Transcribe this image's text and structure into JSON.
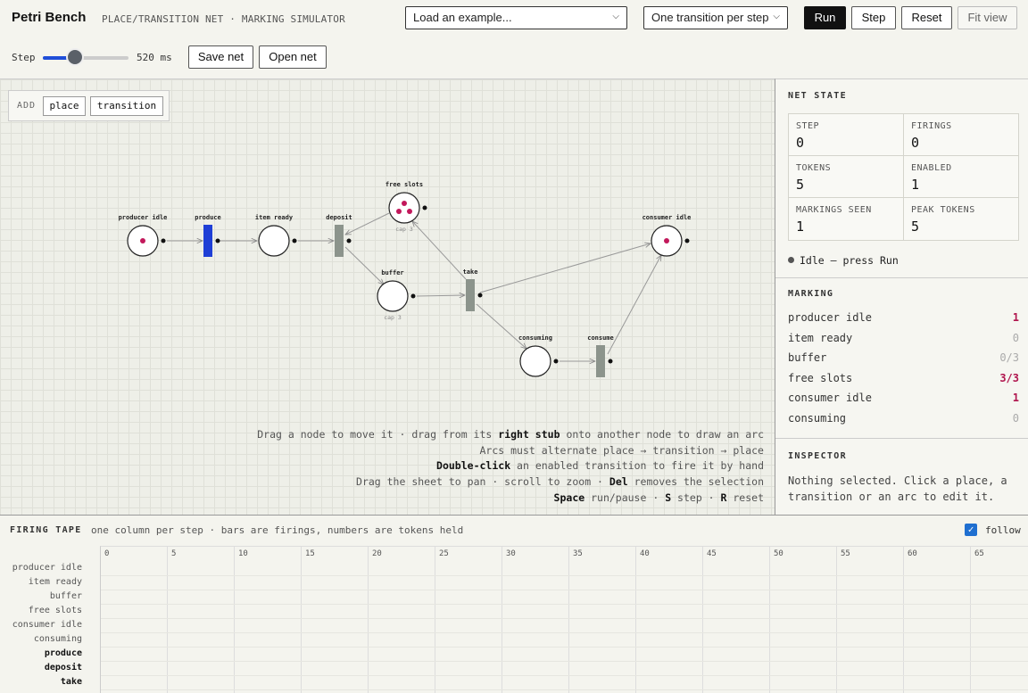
{
  "header": {
    "title": "Petri Bench",
    "subtitle": "PLACE/TRANSITION NET · MARKING SIMULATOR",
    "example_select": "Load an example...",
    "mode_select": "One transition per step",
    "run": "Run",
    "step": "Step",
    "reset": "Reset",
    "fit_view": "Fit view",
    "step_label": "Step",
    "step_ms": "520 ms",
    "step_slider_fraction": 0.38,
    "save_net": "Save net",
    "open_net": "Open net"
  },
  "canvas": {
    "add_label": "ADD",
    "add_place": "place",
    "add_transition": "transition",
    "help": [
      {
        "parts": [
          [
            "Drag a node to move it · drag from its ",
            false
          ],
          [
            "right stub",
            true
          ],
          [
            " onto another node to draw an arc",
            false
          ]
        ]
      },
      {
        "parts": [
          [
            "Arcs must alternate place → transition → place",
            false
          ]
        ]
      },
      {
        "parts": [
          [
            "Double-click",
            true
          ],
          [
            " an enabled transition to fire it by hand",
            false
          ]
        ]
      },
      {
        "parts": [
          [
            "Drag the sheet to pan · scroll to zoom · ",
            false
          ],
          [
            "Del",
            true
          ],
          [
            " removes the selection",
            false
          ]
        ]
      },
      {
        "parts": [
          [
            "Space",
            true
          ],
          [
            " run/pause · ",
            false
          ],
          [
            "S",
            true
          ],
          [
            " step · ",
            false
          ],
          [
            "R",
            true
          ],
          [
            " reset",
            false
          ]
        ]
      }
    ]
  },
  "net": {
    "places": [
      {
        "id": "producer_idle",
        "label": "producer idle",
        "tokens": 1,
        "cap": ""
      },
      {
        "id": "item_ready",
        "label": "item ready",
        "tokens": 0,
        "cap": ""
      },
      {
        "id": "free_slots",
        "label": "free slots",
        "tokens": 3,
        "cap": "cap 3"
      },
      {
        "id": "buffer",
        "label": "buffer",
        "tokens": 0,
        "cap": "cap 3"
      },
      {
        "id": "consumer_idle",
        "label": "consumer idle",
        "tokens": 1,
        "cap": ""
      },
      {
        "id": "consuming",
        "label": "consuming",
        "tokens": 0,
        "cap": ""
      }
    ],
    "transitions": [
      {
        "id": "produce",
        "label": "produce",
        "enabled": true
      },
      {
        "id": "deposit",
        "label": "deposit",
        "enabled": false
      },
      {
        "id": "take",
        "label": "take",
        "enabled": false
      },
      {
        "id": "consume",
        "label": "consume",
        "enabled": false
      }
    ],
    "token_color": "#c2185b",
    "enabled_color": "#1f3fd6",
    "disabled_color": "#8c948c"
  },
  "net_state": {
    "heading": "NET STATE",
    "stats": [
      {
        "k": "STEP",
        "v": "0"
      },
      {
        "k": "FIRINGS",
        "v": "0"
      },
      {
        "k": "TOKENS",
        "v": "5"
      },
      {
        "k": "ENABLED",
        "v": "1"
      },
      {
        "k": "MARKINGS SEEN",
        "v": "1"
      },
      {
        "k": "PEAK TOKENS",
        "v": "5"
      }
    ],
    "status": "Idle — press Run"
  },
  "marking": {
    "heading": "MARKING",
    "rows": [
      {
        "name": "producer idle",
        "value": "1",
        "hi": true
      },
      {
        "name": "item ready",
        "value": "0",
        "hi": false
      },
      {
        "name": "buffer",
        "value": "0/3",
        "hi": false
      },
      {
        "name": "free slots",
        "value": "3/3",
        "hi": true
      },
      {
        "name": "consumer idle",
        "value": "1",
        "hi": true
      },
      {
        "name": "consuming",
        "value": "0",
        "hi": false
      }
    ]
  },
  "inspector": {
    "heading": "INSPECTOR",
    "text": "Nothing selected. Click a place, a transition or an arc to edit it."
  },
  "tape": {
    "title": "FIRING TAPE",
    "subtitle": "one column per step · bars are firings, numbers are tokens held",
    "follow_label": "follow",
    "follow_checked": true,
    "ticks": [
      "0",
      "5",
      "10",
      "15",
      "20",
      "25",
      "30",
      "35",
      "40",
      "45",
      "50",
      "55",
      "60",
      "65"
    ],
    "rows": [
      {
        "label": "producer idle",
        "kind": "place"
      },
      {
        "label": "item ready",
        "kind": "place"
      },
      {
        "label": "buffer",
        "kind": "place"
      },
      {
        "label": "free slots",
        "kind": "place"
      },
      {
        "label": "consumer idle",
        "kind": "place"
      },
      {
        "label": "consuming",
        "kind": "place"
      },
      {
        "label": "produce",
        "kind": "transition"
      },
      {
        "label": "deposit",
        "kind": "transition"
      },
      {
        "label": "take",
        "kind": "transition"
      }
    ]
  }
}
